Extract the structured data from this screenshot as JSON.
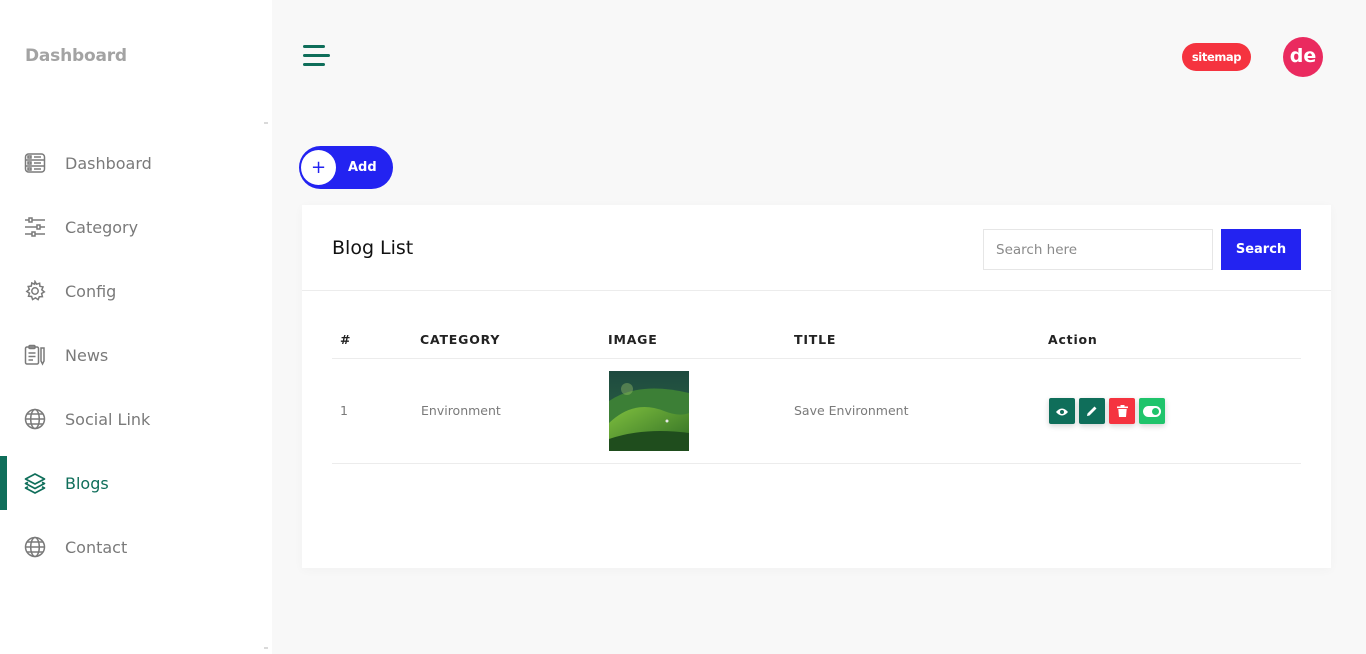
{
  "sidebar": {
    "brand": "Dashboard",
    "items": [
      {
        "label": "Dashboard",
        "icon": "dashboard-icon"
      },
      {
        "label": "Category",
        "icon": "sliders-icon"
      },
      {
        "label": "Config",
        "icon": "gear-icon"
      },
      {
        "label": "News",
        "icon": "clipboard-icon"
      },
      {
        "label": "Social Link",
        "icon": "globe-icon"
      },
      {
        "label": "Blogs",
        "icon": "layers-icon",
        "active": true
      },
      {
        "label": "Contact",
        "icon": "globe-icon"
      }
    ]
  },
  "header": {
    "menu_icon": "hamburger-icon",
    "sitemap_label": "sitemap",
    "avatar_initials": "de"
  },
  "toolbar": {
    "add_label": "Add",
    "add_icon": "+"
  },
  "blog_list": {
    "title": "Blog List",
    "search": {
      "placeholder": "Search here",
      "value": "",
      "button_label": "Search"
    },
    "columns": [
      "#",
      "CATEGORY",
      "IMAGE",
      "TITLE",
      "Action"
    ],
    "rows": [
      {
        "index": "1",
        "category": "Environment",
        "image": "green-hills-thumbnail",
        "title": "Save Environment",
        "actions": [
          "eye-icon",
          "pencil-icon",
          "trash-icon",
          "toggle-icon"
        ]
      }
    ]
  },
  "colors": {
    "accent": "#0f6e5a",
    "primary": "#2323f1",
    "danger": "#f5333f",
    "avatar": "#ea2a5f",
    "toggle": "#1fc46b"
  }
}
